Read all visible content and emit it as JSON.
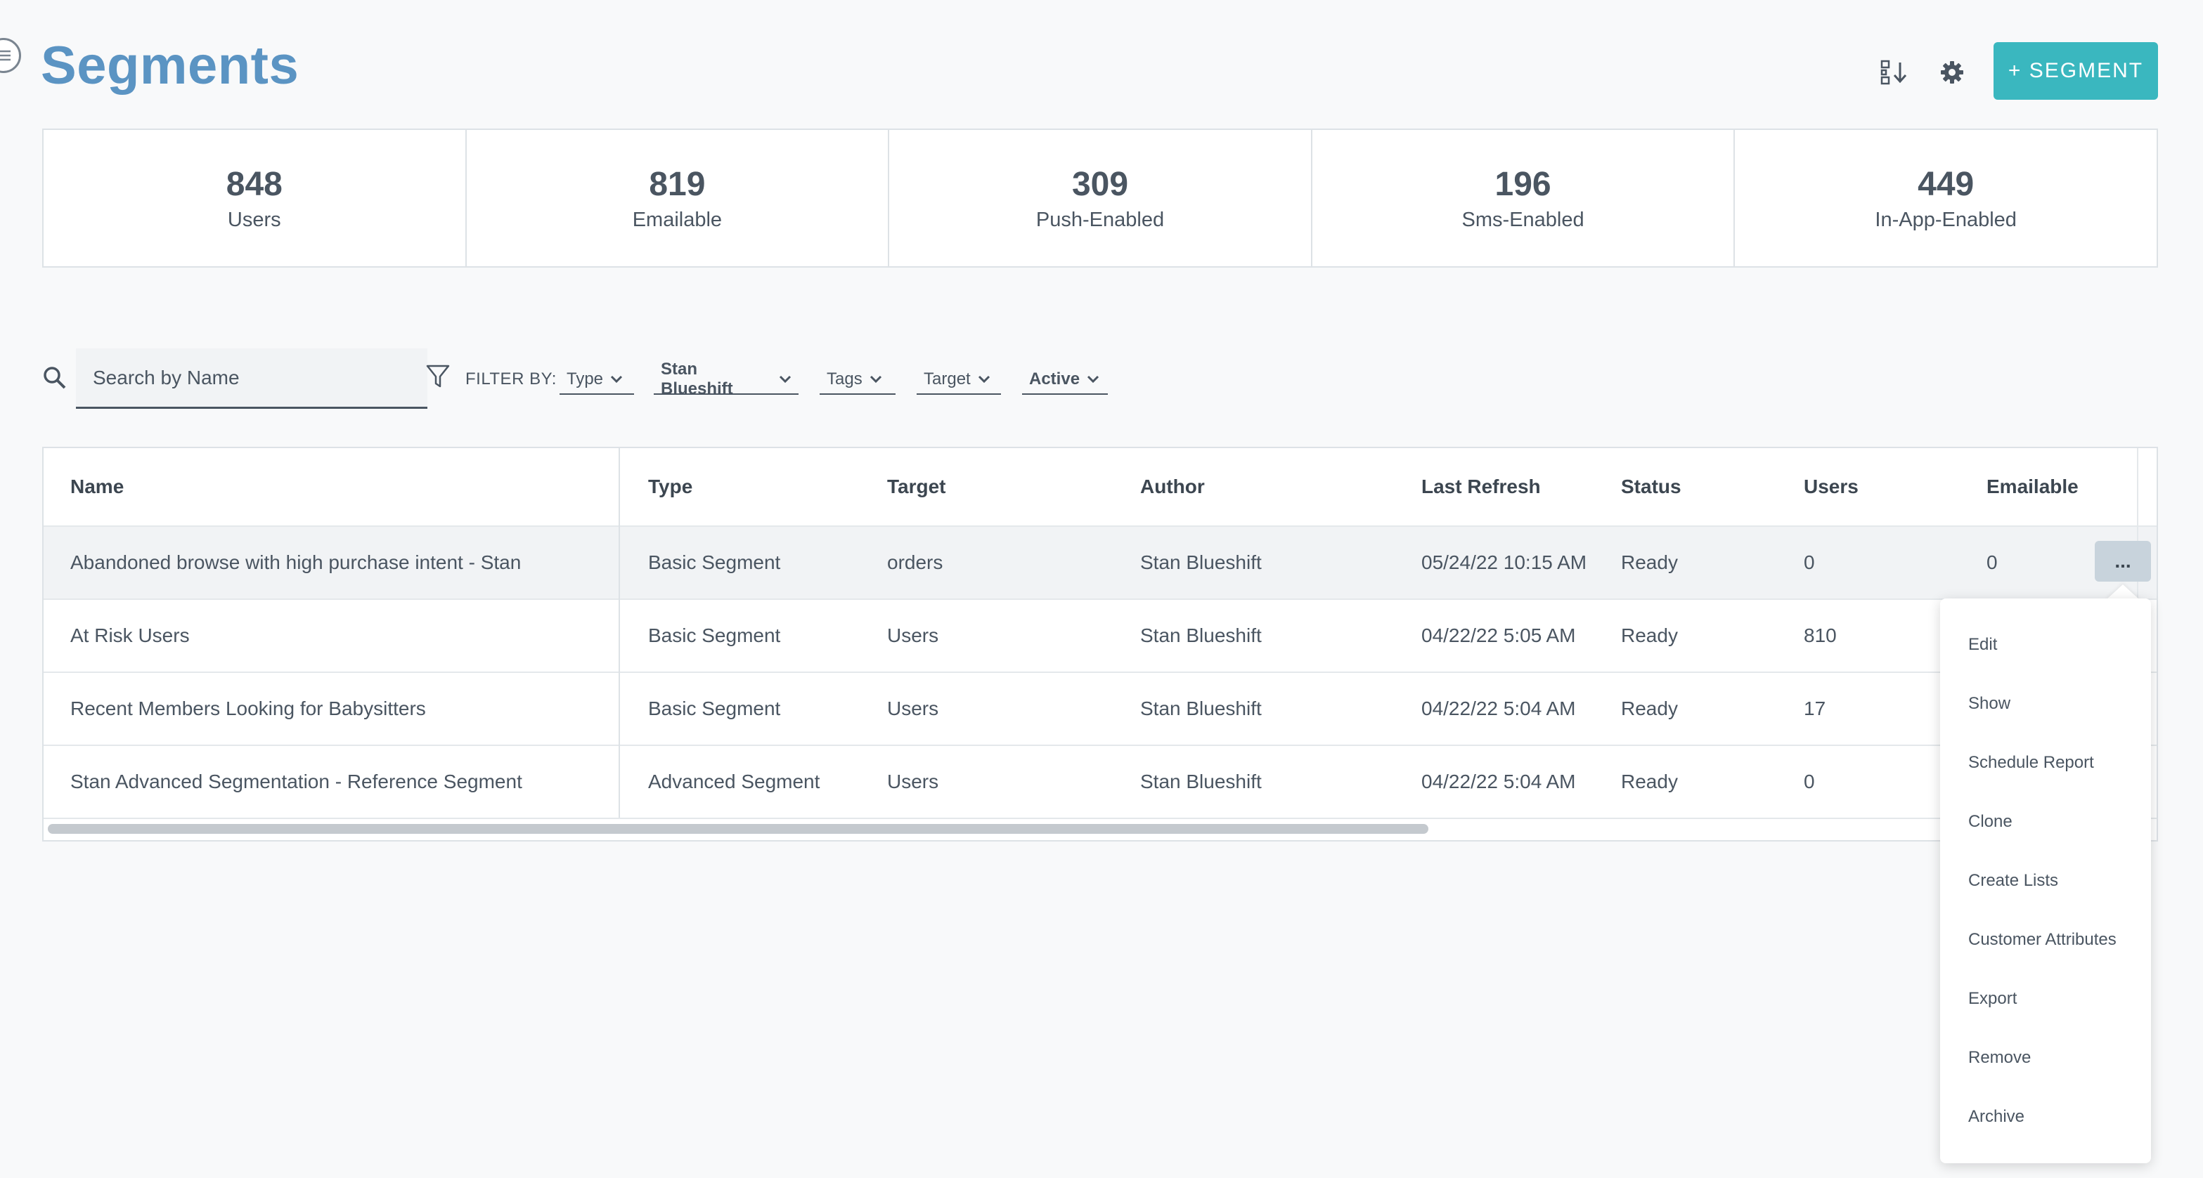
{
  "header": {
    "title": "Segments",
    "add_button_label": "+ SEGMENT",
    "icons": [
      "menu-icon",
      "sort-icon",
      "gear-icon"
    ]
  },
  "stats": [
    {
      "value": "848",
      "label": "Users"
    },
    {
      "value": "819",
      "label": "Emailable"
    },
    {
      "value": "309",
      "label": "Push-Enabled"
    },
    {
      "value": "196",
      "label": "Sms-Enabled"
    },
    {
      "value": "449",
      "label": "In-App-Enabled"
    }
  ],
  "filters": {
    "search_placeholder": "Search by Name",
    "filter_by_label": "FILTER BY:",
    "dropdowns": [
      {
        "label": "Type"
      },
      {
        "label": "Stan Blueshift"
      },
      {
        "label": "Tags"
      },
      {
        "label": "Target"
      },
      {
        "label": "Active"
      }
    ]
  },
  "table": {
    "columns": [
      "Name",
      "Type",
      "Target",
      "Author",
      "Last Refresh",
      "Status",
      "Users",
      "Emailable"
    ],
    "rows": [
      [
        "Abandoned browse with high purchase intent - Stan",
        "Basic Segment",
        "orders",
        "Stan Blueshift",
        "05/24/22 10:15 AM",
        "Ready",
        "0",
        "0"
      ],
      [
        "At Risk Users",
        "Basic Segment",
        "Users",
        "Stan Blueshift",
        "04/22/22 5:05 AM",
        "Ready",
        "810",
        ""
      ],
      [
        "Recent Members Looking for Babysitters",
        "Basic Segment",
        "Users",
        "Stan Blueshift",
        "04/22/22 5:04 AM",
        "Ready",
        "17",
        ""
      ],
      [
        "Stan Advanced Segmentation - Reference Segment",
        "Advanced Segment",
        "Users",
        "Stan Blueshift",
        "04/22/22 5:04 AM",
        "Ready",
        "0",
        ""
      ]
    ],
    "more_button_label": "..."
  },
  "row_menu": {
    "items": [
      "Edit",
      "Show",
      "Schedule Report",
      "Clone",
      "Create Lists",
      "Customer Attributes",
      "Export",
      "Remove",
      "Archive"
    ]
  },
  "colors": {
    "title": "#5b94c3",
    "accent": "#3ab7bf",
    "text": "#4a5561"
  }
}
